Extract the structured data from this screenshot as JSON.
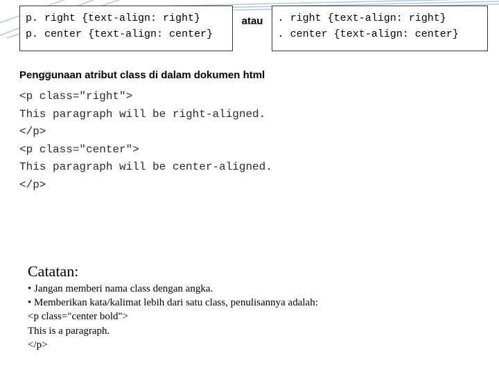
{
  "page_number": "33",
  "top": {
    "left_box": {
      "line1": "p. right {text-align: right}",
      "line2": "p. center {text-align: center}"
    },
    "middle_label": "atau",
    "right_box": {
      "line1": ". right {text-align: right}",
      "line2": ". center {text-align: center}"
    }
  },
  "section_title": "Penggunaan atribut class di dalam dokumen html",
  "html_example": {
    "l1": "<p class=\"right\">",
    "l2": "This paragraph will be right-aligned.",
    "l3": "</p>",
    "l4": "<p class=\"center\">",
    "l5": "This paragraph will be center-aligned.",
    "l6": "</p>"
  },
  "notes": {
    "title": "Catatan:",
    "b1": "• Jangan memberi nama class dengan angka.",
    "b2": "• Memberikan kata/kalimat lebih dari satu class, penulisannya adalah:",
    "l3": "<p class=\"center bold\">",
    "l4": "This is a paragraph.",
    "l5": "</p>"
  }
}
